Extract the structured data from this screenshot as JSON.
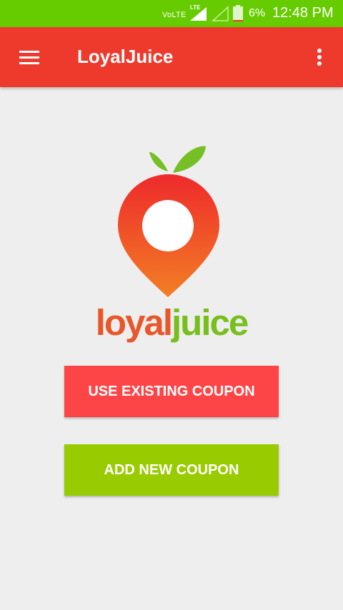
{
  "status_bar": {
    "network": "VoLTE",
    "lte_badge": "LTE",
    "battery_percent": "6%",
    "time": "12:48 PM",
    "battery_level": 0.06
  },
  "app_bar": {
    "title": "LoyalJuice",
    "background_color": "#ee3a2c"
  },
  "logo": {
    "text_part1": "loyal",
    "text_part2": "juice"
  },
  "buttons": {
    "use_existing": "USE EXISTING COUPON",
    "add_new": "ADD NEW COUPON"
  },
  "colors": {
    "status_bar": "#66cc00",
    "use_existing_button": "#fd4548",
    "add_new_button": "#99cc00"
  }
}
